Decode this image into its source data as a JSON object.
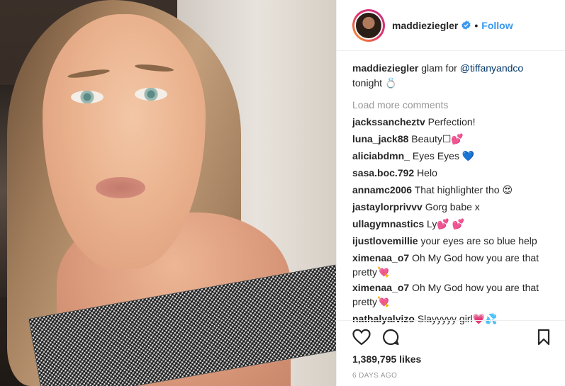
{
  "post": {
    "username": "maddieziegler",
    "follow_label": "Follow",
    "dot": "•",
    "caption": {
      "username": "maddieziegler",
      "text_before": "glam for",
      "mention": "@tiffanyandco",
      "text_after": "tonight 💍"
    },
    "load_more": "Load more comments",
    "comments": [
      {
        "user": "jackssancheztv",
        "text": "Perfection!"
      },
      {
        "user": "luna_jack88",
        "text": "Beauty☐💕"
      },
      {
        "user": "aliciabdmn_",
        "text": "Eyes Eyes 💙"
      },
      {
        "user": "sasa.boc.792",
        "text": "Helo"
      },
      {
        "user": "annamc2006",
        "text": "That highlighter tho 😍"
      },
      {
        "user": "jastaylorprivvv",
        "text": "Gorg babe x"
      },
      {
        "user": "ullagymnastics",
        "text": "Ly💕 💕"
      },
      {
        "user": "ijustlovemillie",
        "text": "your eyes are so blue help"
      },
      {
        "user": "ximenaa_o7",
        "text": "Oh My God how you are that pretty💘"
      },
      {
        "user": "ximenaa_o7",
        "text": "Oh My God how you are that pretty💘"
      },
      {
        "user": "nathalyalvizo",
        "text": "Slayyyyy girl💗💦"
      }
    ],
    "likes": "1,389,795 likes",
    "age": "6 DAYS AGO"
  },
  "icons": [
    "verified-badge-icon",
    "heart-icon",
    "comment-icon",
    "bookmark-icon"
  ],
  "colors": {
    "link": "#3897f0",
    "mention": "#003569",
    "muted": "#999999"
  }
}
